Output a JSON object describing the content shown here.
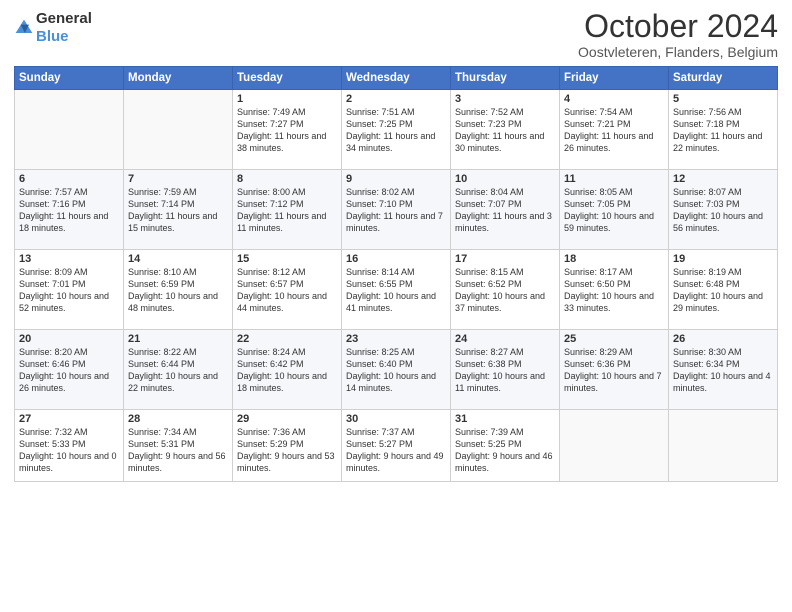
{
  "header": {
    "logo": {
      "text_general": "General",
      "text_blue": "Blue"
    },
    "title": "October 2024",
    "location": "Oostvleteren, Flanders, Belgium"
  },
  "weekdays": [
    "Sunday",
    "Monday",
    "Tuesday",
    "Wednesday",
    "Thursday",
    "Friday",
    "Saturday"
  ],
  "weeks": [
    [
      {
        "day": "",
        "sunrise": "",
        "sunset": "",
        "daylight": ""
      },
      {
        "day": "",
        "sunrise": "",
        "sunset": "",
        "daylight": ""
      },
      {
        "day": "1",
        "sunrise": "Sunrise: 7:49 AM",
        "sunset": "Sunset: 7:27 PM",
        "daylight": "Daylight: 11 hours and 38 minutes."
      },
      {
        "day": "2",
        "sunrise": "Sunrise: 7:51 AM",
        "sunset": "Sunset: 7:25 PM",
        "daylight": "Daylight: 11 hours and 34 minutes."
      },
      {
        "day": "3",
        "sunrise": "Sunrise: 7:52 AM",
        "sunset": "Sunset: 7:23 PM",
        "daylight": "Daylight: 11 hours and 30 minutes."
      },
      {
        "day": "4",
        "sunrise": "Sunrise: 7:54 AM",
        "sunset": "Sunset: 7:21 PM",
        "daylight": "Daylight: 11 hours and 26 minutes."
      },
      {
        "day": "5",
        "sunrise": "Sunrise: 7:56 AM",
        "sunset": "Sunset: 7:18 PM",
        "daylight": "Daylight: 11 hours and 22 minutes."
      }
    ],
    [
      {
        "day": "6",
        "sunrise": "Sunrise: 7:57 AM",
        "sunset": "Sunset: 7:16 PM",
        "daylight": "Daylight: 11 hours and 18 minutes."
      },
      {
        "day": "7",
        "sunrise": "Sunrise: 7:59 AM",
        "sunset": "Sunset: 7:14 PM",
        "daylight": "Daylight: 11 hours and 15 minutes."
      },
      {
        "day": "8",
        "sunrise": "Sunrise: 8:00 AM",
        "sunset": "Sunset: 7:12 PM",
        "daylight": "Daylight: 11 hours and 11 minutes."
      },
      {
        "day": "9",
        "sunrise": "Sunrise: 8:02 AM",
        "sunset": "Sunset: 7:10 PM",
        "daylight": "Daylight: 11 hours and 7 minutes."
      },
      {
        "day": "10",
        "sunrise": "Sunrise: 8:04 AM",
        "sunset": "Sunset: 7:07 PM",
        "daylight": "Daylight: 11 hours and 3 minutes."
      },
      {
        "day": "11",
        "sunrise": "Sunrise: 8:05 AM",
        "sunset": "Sunset: 7:05 PM",
        "daylight": "Daylight: 10 hours and 59 minutes."
      },
      {
        "day": "12",
        "sunrise": "Sunrise: 8:07 AM",
        "sunset": "Sunset: 7:03 PM",
        "daylight": "Daylight: 10 hours and 56 minutes."
      }
    ],
    [
      {
        "day": "13",
        "sunrise": "Sunrise: 8:09 AM",
        "sunset": "Sunset: 7:01 PM",
        "daylight": "Daylight: 10 hours and 52 minutes."
      },
      {
        "day": "14",
        "sunrise": "Sunrise: 8:10 AM",
        "sunset": "Sunset: 6:59 PM",
        "daylight": "Daylight: 10 hours and 48 minutes."
      },
      {
        "day": "15",
        "sunrise": "Sunrise: 8:12 AM",
        "sunset": "Sunset: 6:57 PM",
        "daylight": "Daylight: 10 hours and 44 minutes."
      },
      {
        "day": "16",
        "sunrise": "Sunrise: 8:14 AM",
        "sunset": "Sunset: 6:55 PM",
        "daylight": "Daylight: 10 hours and 41 minutes."
      },
      {
        "day": "17",
        "sunrise": "Sunrise: 8:15 AM",
        "sunset": "Sunset: 6:52 PM",
        "daylight": "Daylight: 10 hours and 37 minutes."
      },
      {
        "day": "18",
        "sunrise": "Sunrise: 8:17 AM",
        "sunset": "Sunset: 6:50 PM",
        "daylight": "Daylight: 10 hours and 33 minutes."
      },
      {
        "day": "19",
        "sunrise": "Sunrise: 8:19 AM",
        "sunset": "Sunset: 6:48 PM",
        "daylight": "Daylight: 10 hours and 29 minutes."
      }
    ],
    [
      {
        "day": "20",
        "sunrise": "Sunrise: 8:20 AM",
        "sunset": "Sunset: 6:46 PM",
        "daylight": "Daylight: 10 hours and 26 minutes."
      },
      {
        "day": "21",
        "sunrise": "Sunrise: 8:22 AM",
        "sunset": "Sunset: 6:44 PM",
        "daylight": "Daylight: 10 hours and 22 minutes."
      },
      {
        "day": "22",
        "sunrise": "Sunrise: 8:24 AM",
        "sunset": "Sunset: 6:42 PM",
        "daylight": "Daylight: 10 hours and 18 minutes."
      },
      {
        "day": "23",
        "sunrise": "Sunrise: 8:25 AM",
        "sunset": "Sunset: 6:40 PM",
        "daylight": "Daylight: 10 hours and 14 minutes."
      },
      {
        "day": "24",
        "sunrise": "Sunrise: 8:27 AM",
        "sunset": "Sunset: 6:38 PM",
        "daylight": "Daylight: 10 hours and 11 minutes."
      },
      {
        "day": "25",
        "sunrise": "Sunrise: 8:29 AM",
        "sunset": "Sunset: 6:36 PM",
        "daylight": "Daylight: 10 hours and 7 minutes."
      },
      {
        "day": "26",
        "sunrise": "Sunrise: 8:30 AM",
        "sunset": "Sunset: 6:34 PM",
        "daylight": "Daylight: 10 hours and 4 minutes."
      }
    ],
    [
      {
        "day": "27",
        "sunrise": "Sunrise: 7:32 AM",
        "sunset": "Sunset: 5:33 PM",
        "daylight": "Daylight: 10 hours and 0 minutes."
      },
      {
        "day": "28",
        "sunrise": "Sunrise: 7:34 AM",
        "sunset": "Sunset: 5:31 PM",
        "daylight": "Daylight: 9 hours and 56 minutes."
      },
      {
        "day": "29",
        "sunrise": "Sunrise: 7:36 AM",
        "sunset": "Sunset: 5:29 PM",
        "daylight": "Daylight: 9 hours and 53 minutes."
      },
      {
        "day": "30",
        "sunrise": "Sunrise: 7:37 AM",
        "sunset": "Sunset: 5:27 PM",
        "daylight": "Daylight: 9 hours and 49 minutes."
      },
      {
        "day": "31",
        "sunrise": "Sunrise: 7:39 AM",
        "sunset": "Sunset: 5:25 PM",
        "daylight": "Daylight: 9 hours and 46 minutes."
      },
      {
        "day": "",
        "sunrise": "",
        "sunset": "",
        "daylight": ""
      },
      {
        "day": "",
        "sunrise": "",
        "sunset": "",
        "daylight": ""
      }
    ]
  ]
}
